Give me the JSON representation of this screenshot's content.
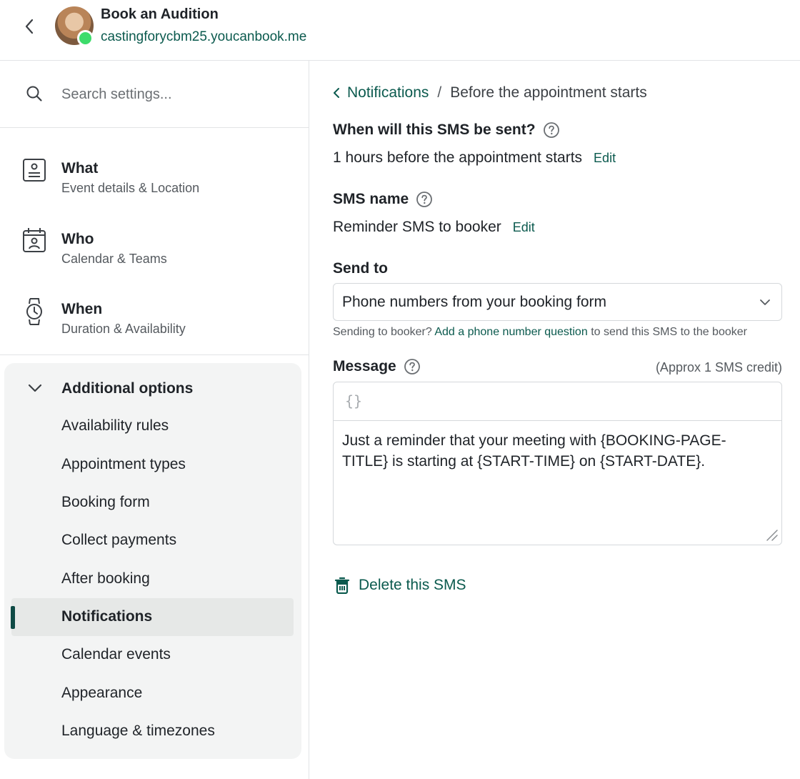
{
  "header": {
    "title": "Book an Audition",
    "url": "castingforycbm25.youcanbook.me"
  },
  "sidebar": {
    "search_placeholder": "Search settings...",
    "items": [
      {
        "title": "What",
        "subtitle": "Event details & Location"
      },
      {
        "title": "Who",
        "subtitle": "Calendar & Teams"
      },
      {
        "title": "When",
        "subtitle": "Duration & Availability"
      }
    ],
    "options_title": "Additional options",
    "options": [
      "Availability rules",
      "Appointment types",
      "Booking form",
      "Collect payments",
      "After booking",
      "Notifications",
      "Calendar events",
      "Appearance",
      "Language & timezones"
    ],
    "active_option": "Notifications"
  },
  "main": {
    "breadcrumb_link": "Notifications",
    "breadcrumb_sep": "/",
    "breadcrumb_current": "Before the appointment starts",
    "when_label": "When will this SMS be sent?",
    "when_value": "1 hours before the appointment starts",
    "edit_label": "Edit",
    "name_label": "SMS name",
    "name_value": "Reminder SMS to booker",
    "send_to_label": "Send to",
    "send_to_value": "Phone numbers from your booking form",
    "hint_prefix": "Sending to booker?",
    "hint_link": "Add a phone number question",
    "hint_suffix": "to send this SMS to the booker",
    "message_label": "Message",
    "credit_note": "(Approx 1 SMS credit)",
    "braces": "{}",
    "message_text": "Just a reminder that your meeting with {BOOKING-PAGE-TITLE} is starting at {START-TIME} on {START-DATE}.",
    "delete_label": "Delete this SMS"
  },
  "colors": {
    "accent": "#0b5a4e",
    "active_bar": "#0e4a45",
    "status_online": "#3ddc6b"
  }
}
